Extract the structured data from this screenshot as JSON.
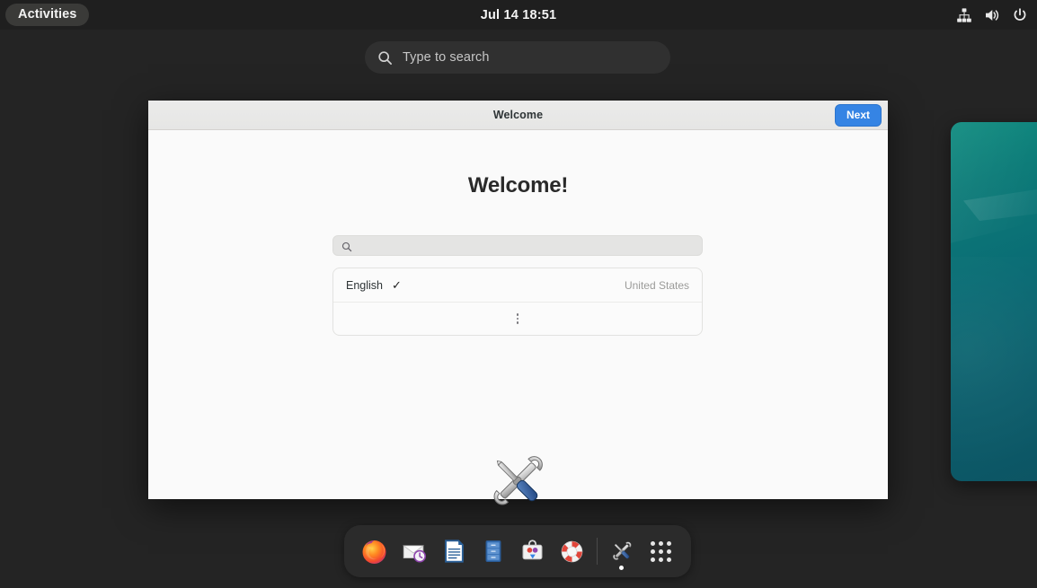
{
  "topbar": {
    "activities_label": "Activities",
    "clock": "Jul 14  18:51",
    "status_icons": [
      {
        "name": "wired-network-icon",
        "label": "Wired Network"
      },
      {
        "name": "volume-icon",
        "label": "Volume"
      },
      {
        "name": "power-icon",
        "label": "Power"
      }
    ]
  },
  "overview": {
    "search_placeholder": "Type to search",
    "search_value": "",
    "search_icon": "search-icon"
  },
  "window": {
    "title": "Welcome",
    "next_label": "Next",
    "heading": "Welcome!",
    "search_placeholder": "",
    "search_value": "",
    "search_icon": "search-icon",
    "language_list": [
      {
        "name": "English",
        "selected": true,
        "check": "✓",
        "region": "United States"
      }
    ],
    "more_label": "More…",
    "app_icon": "tools-icon"
  },
  "dock": {
    "items": [
      {
        "name": "firefox",
        "label": "Firefox Web Browser",
        "icon": "firefox-icon",
        "running": false
      },
      {
        "name": "mail",
        "label": "Mail",
        "icon": "mail-clock-icon",
        "running": false
      },
      {
        "name": "writer",
        "label": "LibreOffice Writer",
        "icon": "document-icon",
        "running": false
      },
      {
        "name": "files",
        "label": "Files",
        "icon": "file-cabinet-icon",
        "running": false
      },
      {
        "name": "software",
        "label": "Software",
        "icon": "software-bag-icon",
        "running": false
      },
      {
        "name": "help",
        "label": "Help",
        "icon": "lifebuoy-icon",
        "running": false
      },
      {
        "name": "welcome",
        "label": "Welcome",
        "icon": "tools-icon",
        "running": true
      }
    ],
    "show_apps_label": "Show Applications",
    "show_apps_icon": "app-grid-icon"
  },
  "colors": {
    "desktop_bg": "#242424",
    "topbar_bg": "#1f1f1f",
    "accent_blue": "#3584e4",
    "headerbar_bg": "#e8e8e7",
    "content_bg": "#fafafa",
    "teal_window": "#0c7b78"
  }
}
